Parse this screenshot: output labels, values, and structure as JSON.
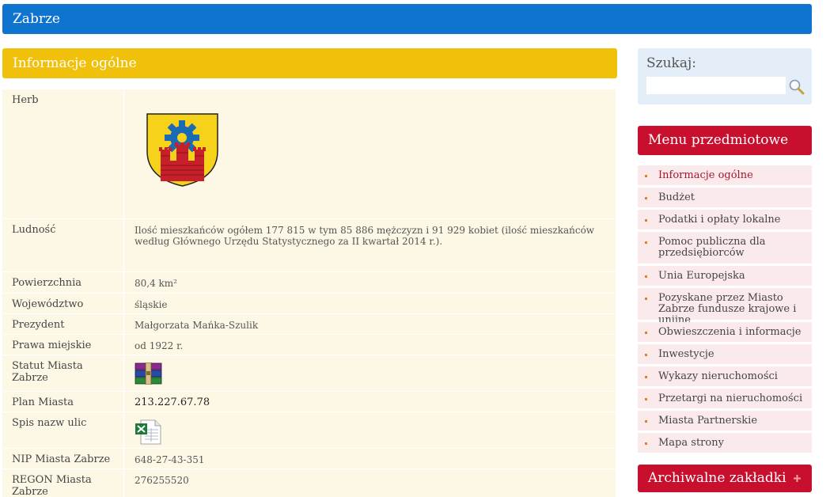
{
  "header": {
    "title": "Zabrze"
  },
  "section": {
    "title": "Informacje ogólne"
  },
  "info": {
    "herb_label": "Herb",
    "ludnosc_label": "Ludność",
    "ludnosc_value": "Ilość mieszkańców ogółem 177 815 w tym 85 886 mężczyzn i 91 929 kobiet (ilość mieszkańców według Głównego Urzędu Statystycznego za II kwartał 2014 r.).",
    "powierzchnia_label": "Powierzchnia",
    "powierzchnia_value": "80,4 km²",
    "wojewodztwo_label": "Województwo",
    "wojewodztwo_value": "śląskie",
    "prezydent_label": "Prezydent",
    "prezydent_value": "Małgorzata Mańka-Szulik",
    "prawa_label": "Prawa miejskie",
    "prawa_value": "od 1922 r.",
    "statut_label": "Statut Miasta Zabrze",
    "statut_icon": "winrar-archive-icon",
    "plan_label": "Plan Miasta",
    "plan_value": "213.227.67.78",
    "spis_label": "Spis nazw ulic",
    "spis_icon": "excel-file-icon",
    "nip_label": "NIP Miasta Zabrze",
    "nip_value": "648-27-43-351",
    "regon_label": "REGON Miasta Zabrze",
    "regon_value": "276255520"
  },
  "search": {
    "title": "Szukaj:",
    "placeholder": "",
    "value": ""
  },
  "menu": {
    "title": "Menu przedmiotowe",
    "items": [
      {
        "label": "Informacje ogólne",
        "active": true
      },
      {
        "label": "Budżet"
      },
      {
        "label": "Podatki i opłaty lokalne"
      },
      {
        "label": "Pomoc publiczna dla przedsiębiorców"
      },
      {
        "label": "Unia Europejska"
      },
      {
        "label": "Pozyskane przez Miasto Zabrze fundusze krajowe i unijne"
      },
      {
        "label": "Obwieszczenia i informacje"
      },
      {
        "label": "Inwestycje"
      },
      {
        "label": "Wykazy nieruchomości"
      },
      {
        "label": "Przetargi na nieruchomości"
      },
      {
        "label": "Miasta Partnerskie"
      },
      {
        "label": "Mapa strony"
      }
    ]
  },
  "archive": {
    "title": "Archiwalne zakładki"
  },
  "colors": {
    "topbar": "#0f74d0",
    "section": "#f1c00a",
    "menu": "#c8102e",
    "table_bg": "#fdf8e6"
  }
}
